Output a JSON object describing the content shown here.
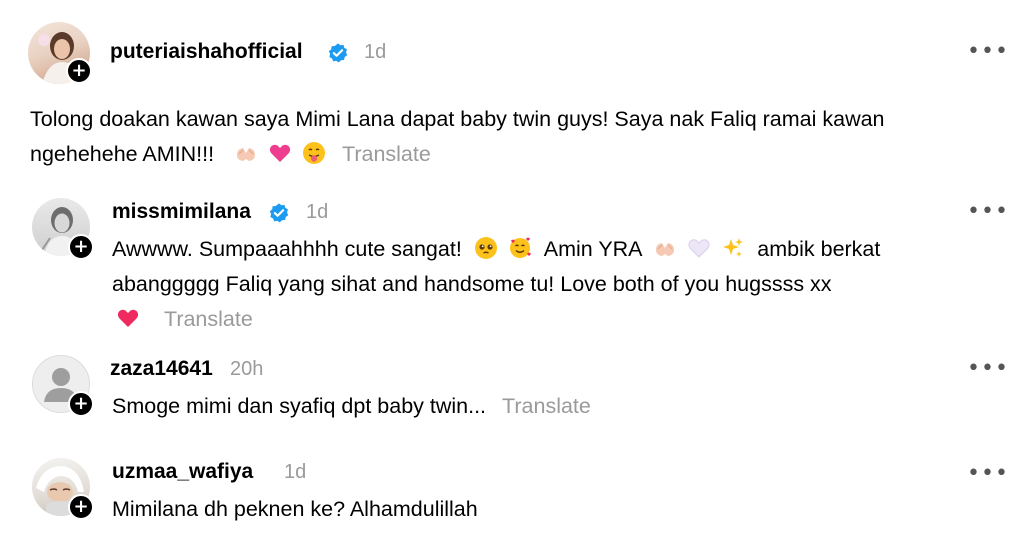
{
  "post": {
    "username": "puteriaishahofficial",
    "time": "1d",
    "text_line1": "Tolong doakan kawan saya Mimi Lana dapat baby twin guys! Saya nak Faliq ramai kawan",
    "text_line2": "ngehehehe AMIN!!!",
    "translate": "Translate",
    "emojis": [
      "folded-hands-icon",
      "pink-heart-icon",
      "tongue-face-icon"
    ]
  },
  "comments": [
    {
      "username": "missmimilana",
      "verified": true,
      "time": "1d",
      "line1_a": "Awwww. Sumpaaahhhh cute sangat!",
      "line1_b": "Amin YRA",
      "line1_c": "ambik berkat",
      "line2": "abanggggg Faliq yang sihat and handsome tu! Love both of you hugssss xx",
      "translate": "Translate"
    },
    {
      "username": "zaza14641",
      "verified": false,
      "time": "20h",
      "line1": "Smoge mimi dan syafiq dpt baby twin...",
      "translate": "Translate"
    },
    {
      "username": "uzmaa_wafiya",
      "verified": false,
      "time": "1d",
      "line1": "Mimilana dh peknen ke? Alhamdulillah"
    }
  ],
  "colors": {
    "verified": "#1d9bf0",
    "muted": "#9a9a9a"
  }
}
